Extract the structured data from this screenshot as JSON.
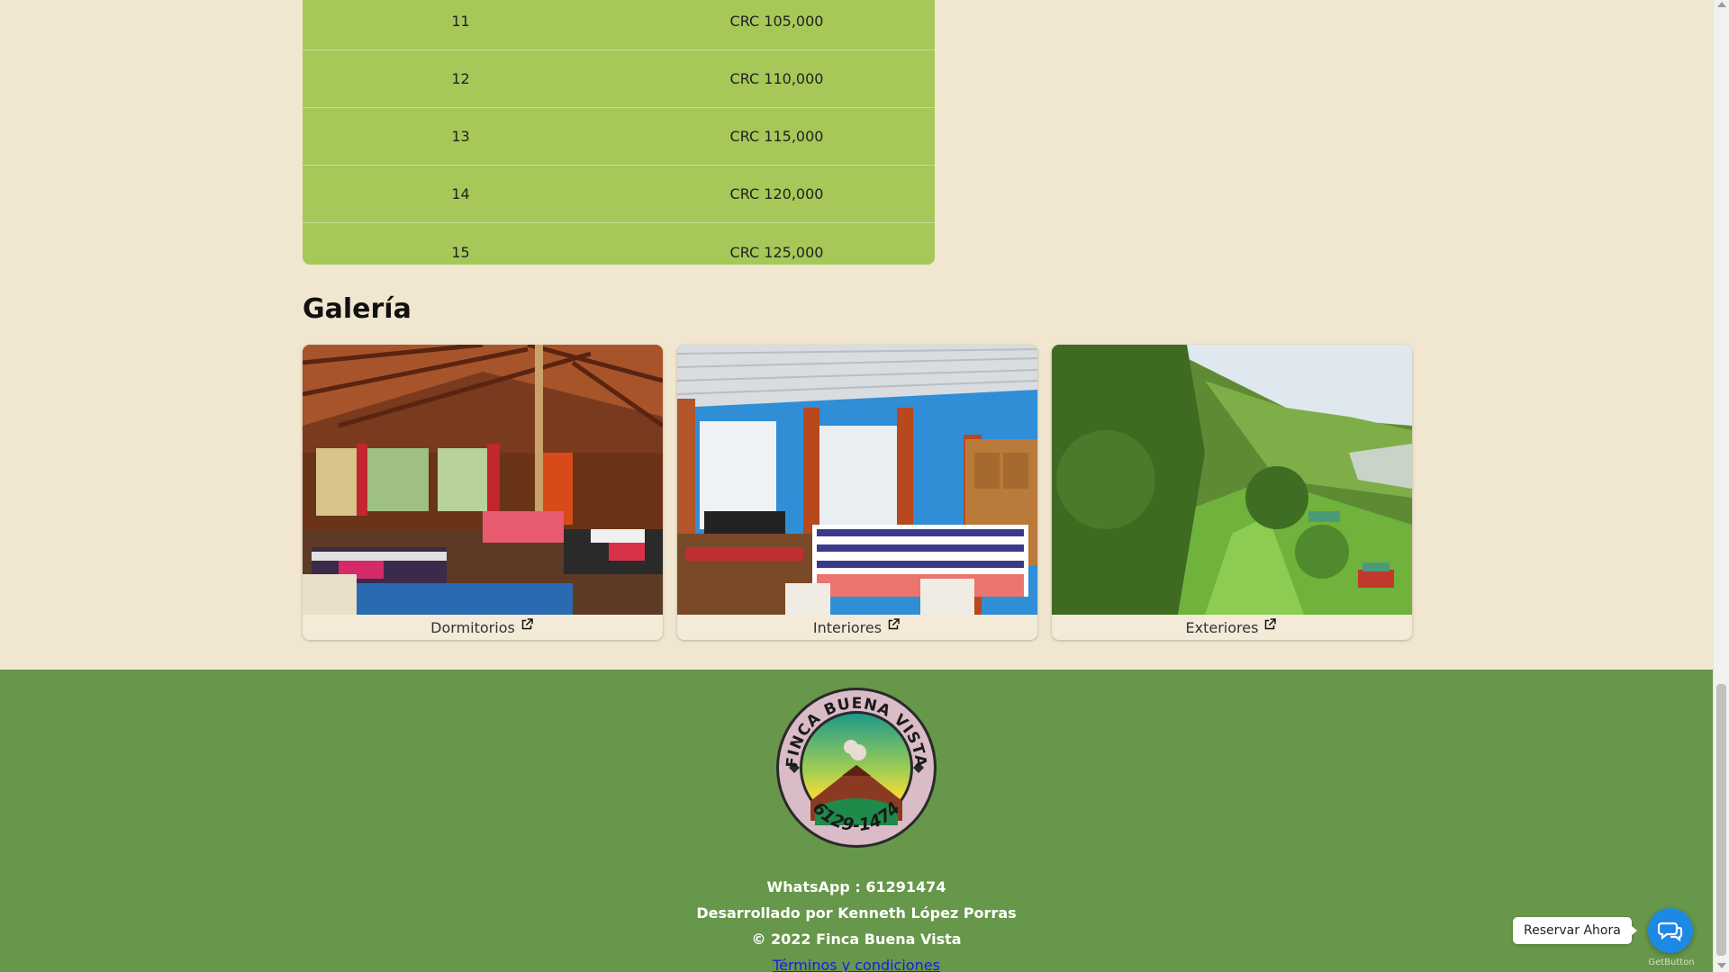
{
  "price_table": {
    "rows": [
      {
        "people": "11",
        "price": "CRC 105,000"
      },
      {
        "people": "12",
        "price": "CRC 110,000"
      },
      {
        "people": "13",
        "price": "CRC 115,000"
      },
      {
        "people": "14",
        "price": "CRC 120,000"
      },
      {
        "people": "15",
        "price": "CRC 125,000"
      }
    ]
  },
  "gallery": {
    "title": "Galería",
    "items": [
      {
        "label": "Dormitorios",
        "icon": "external-link-icon"
      },
      {
        "label": "Interiores",
        "icon": "external-link-icon"
      },
      {
        "label": "Exteriores",
        "icon": "external-link-icon"
      }
    ]
  },
  "footer": {
    "logo": {
      "top_text": "FINCA BUENA VISTA",
      "bottom_text": "6129-1474"
    },
    "whatsapp": "WhatsApp : 61291474",
    "developer": "Desarrollado por Kenneth López Porras",
    "copyright": "© 2022 Finca Buena Vista",
    "terms_link": "Términos y condiciones"
  },
  "chat": {
    "label": "Reservar Ahora",
    "icon": "chat-bubbles-icon",
    "brand": "GetButton"
  },
  "colors": {
    "page_bg": "#f1e7d1",
    "table_green": "#a6c858",
    "footer_green": "#67974a",
    "chat_blue": "#1e88e5",
    "link_blue": "#1a1aee"
  }
}
